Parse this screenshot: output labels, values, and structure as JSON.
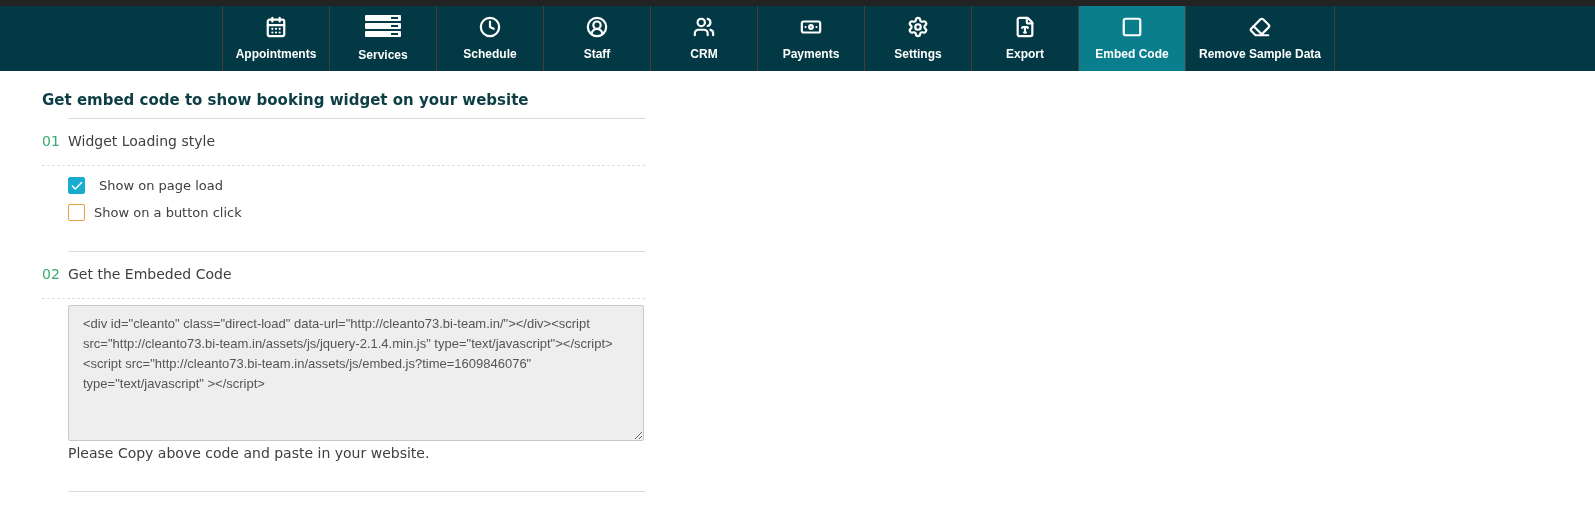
{
  "nav": {
    "tabs": [
      {
        "label": "Appointments",
        "selected": false
      },
      {
        "label": "Services",
        "selected": false
      },
      {
        "label": "Schedule",
        "selected": false
      },
      {
        "label": "Staff",
        "selected": false
      },
      {
        "label": "CRM",
        "selected": false
      },
      {
        "label": "Payments",
        "selected": false
      },
      {
        "label": "Settings",
        "selected": false
      },
      {
        "label": "Export",
        "selected": false
      },
      {
        "label": "Embed Code",
        "selected": true
      },
      {
        "label": "Remove Sample Data",
        "selected": false
      }
    ]
  },
  "page": {
    "title": "Get embed code to show booking widget on your website",
    "steps": [
      {
        "number": "01",
        "title": "Widget Loading style",
        "kind": "options",
        "options": [
          {
            "label": "Show on page load",
            "checked": true
          },
          {
            "label": "Show on a button click",
            "checked": false
          }
        ]
      },
      {
        "number": "02",
        "title": "Get the Embeded Code",
        "kind": "code",
        "code": "<div id=\"cleanto\" class=\"direct-load\" data-url=\"http://cleanto73.bi-team.in/\"></div><script src=\"http://cleanto73.bi-team.in/assets/js/jquery-2.1.4.min.js\" type=\"text/javascript\"></script><script src=\"http://cleanto73.bi-team.in/assets/js/embed.js?time=1609846076\" type=\"text/javascript\" ></script>",
        "note": "Please Copy above code and paste in your website."
      }
    ]
  }
}
